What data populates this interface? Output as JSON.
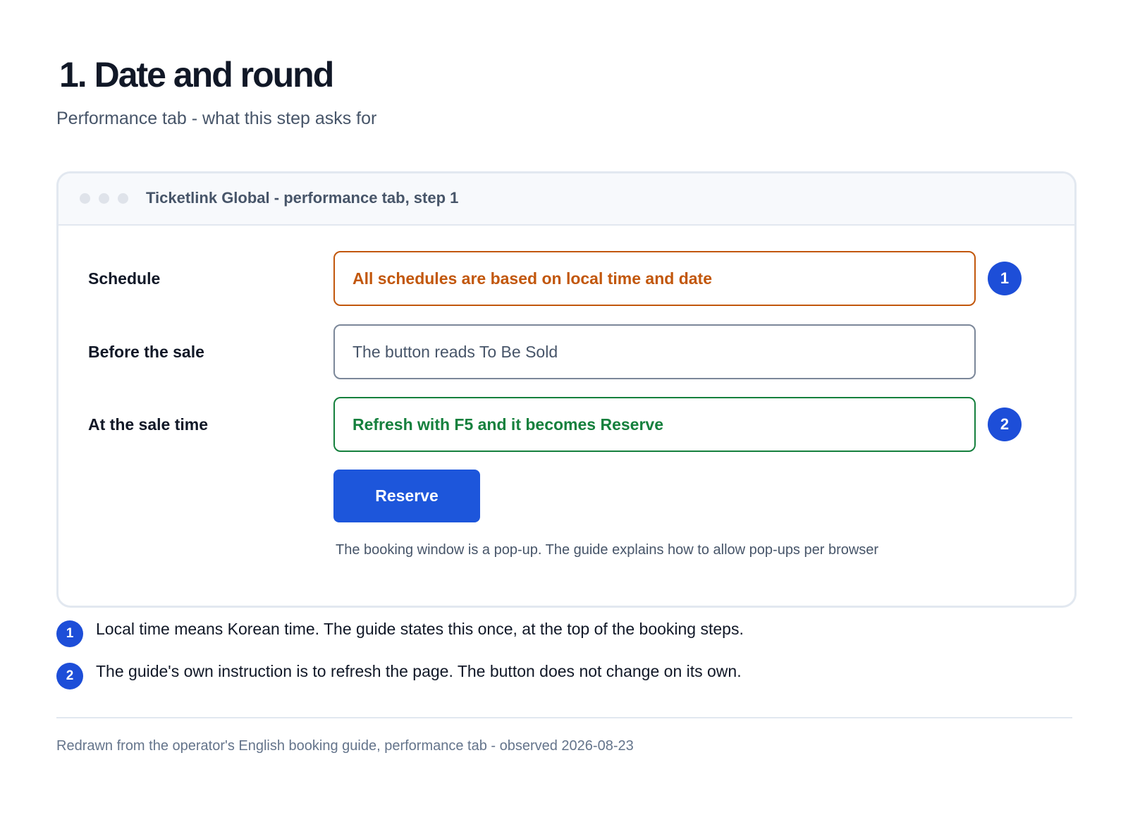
{
  "header": {
    "title": "1. Date and round",
    "subtitle": "Performance tab - what this step asks for"
  },
  "window": {
    "title": "Ticketlink Global - performance tab, step 1",
    "rows": [
      {
        "label": "Schedule",
        "value": "All schedules are based on local time and date",
        "marker": "1",
        "style": "orange",
        "color": "#c2570c"
      },
      {
        "label": "Before the sale",
        "value": "The button reads To Be Sold",
        "marker": "",
        "style": "gray",
        "color": "#64748b"
      },
      {
        "label": "At the sale time",
        "value": "Refresh with F5 and it becomes Reserve",
        "marker": "2",
        "style": "green",
        "color": "#15803d"
      }
    ],
    "button_label": "Reserve",
    "note": "The booking window is a pop-up. The guide explains how to allow pop-ups per browser"
  },
  "notes": [
    {
      "number": "1",
      "text": "Local time means Korean time. The guide states this once, at the top of the booking steps."
    },
    {
      "number": "2",
      "text": "The guide's own instruction is to refresh the page. The button does not change on its own."
    }
  ],
  "footer": "Redrawn from the operator's English booking guide, performance tab - observed 2026-08-23",
  "colors": {
    "accent": "#1d4ed8",
    "button": "#1d56db",
    "warning": "#c2570c",
    "success": "#15803d"
  }
}
